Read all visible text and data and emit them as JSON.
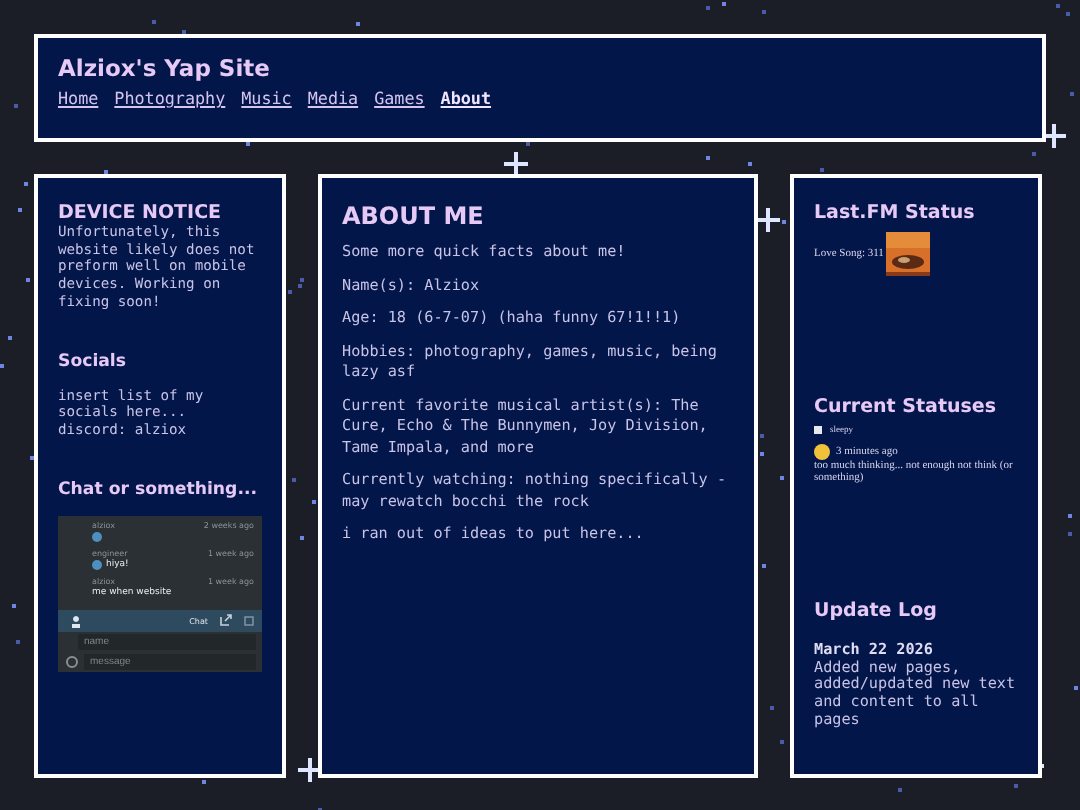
{
  "header": {
    "title": "Alziox's Yap Site",
    "nav": [
      {
        "label": "Home",
        "selected": false
      },
      {
        "label": "Photography",
        "selected": false
      },
      {
        "label": "Music",
        "selected": false
      },
      {
        "label": "Media",
        "selected": false
      },
      {
        "label": "Games",
        "selected": false
      },
      {
        "label": "About",
        "selected": true
      }
    ]
  },
  "left": {
    "notice_title": "DEVICE NOTICE",
    "notice_text": "Unfortunately, this website likely does not preform well on mobile devices. Working on fixing soon!",
    "socials_title": "Socials",
    "socials_lines": [
      "insert list of my socials here...",
      "discord: alziox"
    ],
    "chat_title": "Chat or something...",
    "chat": {
      "messages": [
        {
          "user": "alziox",
          "time": "2 weeks ago",
          "avatar": true
        },
        {
          "user": "engineer",
          "time": "1 week ago",
          "text": "hiya!",
          "avatar": true
        },
        {
          "user": "alziox",
          "time": "1 week ago",
          "text": "me when website",
          "avatar": false
        }
      ],
      "bar_label": "Chat",
      "name_placeholder": "name",
      "message_placeholder": "message"
    }
  },
  "main": {
    "title": "ABOUT ME",
    "paragraphs": [
      "Some more quick facts about me!",
      "Name(s): Alziox",
      "Age: 18 (6-7-07) (haha funny 67!1!!1)",
      "Hobbies: photography, games, music, being lazy asf",
      "Current favorite musical artist(s): The Cure, Echo & The Bunnymen, Joy Division, Tame Impala, and more",
      "Currently watching: nothing specifically - may rewatch bocchi the rock",
      "i ran out of ideas to put here..."
    ]
  },
  "right": {
    "lastfm_title": "Last.FM Status",
    "song": "Love Song: 311",
    "statuses_title": "Current Statuses",
    "mood": "sleepy",
    "status_time": "3 minutes ago",
    "status_text": "too much thinking... not enough not think (or something)",
    "log_title": "Update Log",
    "log_date": "March 22 2026",
    "log_text": "Added new pages, added/updated new text and content to all pages"
  }
}
